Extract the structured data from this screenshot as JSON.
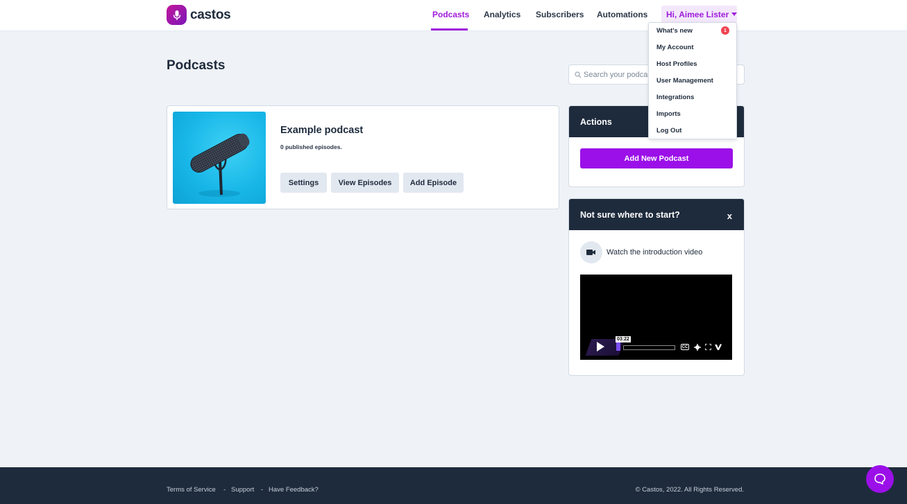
{
  "brand": {
    "name": "castos",
    "accent": "#9f1cdc",
    "dark": "#1e2b3c"
  },
  "nav": {
    "items": [
      {
        "label": "Podcasts",
        "active": true
      },
      {
        "label": "Analytics",
        "active": false
      },
      {
        "label": "Subscribers",
        "active": false
      },
      {
        "label": "Automations",
        "active": false
      }
    ],
    "user_label": "Hi, Aimee Lister"
  },
  "user_menu": {
    "items": [
      {
        "label": "What's new",
        "badge": "1"
      },
      {
        "label": "My Account"
      },
      {
        "label": "Host Profiles"
      },
      {
        "label": "User Management"
      },
      {
        "label": "Integrations"
      },
      {
        "label": "Imports"
      },
      {
        "label": "Log Out"
      }
    ]
  },
  "page": {
    "title": "Podcasts"
  },
  "search": {
    "placeholder": "Search your podcasts",
    "value": ""
  },
  "podcast": {
    "name": "Example podcast",
    "episodes_text": "0 published episodes.",
    "buttons": {
      "settings": "Settings",
      "view_episodes": "View Episodes",
      "add_episode": "Add Episode"
    }
  },
  "actions": {
    "title": "Actions",
    "add_button": "Add New Podcast"
  },
  "start": {
    "title": "Not sure where to start?",
    "close": "x",
    "watch_text": "Watch the introduction video",
    "video": {
      "time": "03:22",
      "cc": "CC",
      "progress": 0.05
    }
  },
  "footer": {
    "links": [
      "Terms of Service",
      "Support",
      "Have Feedback?"
    ],
    "separator": "-",
    "copyright": "© Castos, 2022. All Rights Reserved."
  },
  "icons": {
    "logo": "microphone-icon",
    "search": "search-icon",
    "video": "video-camera-icon",
    "chat": "chat-bubble-icon"
  }
}
